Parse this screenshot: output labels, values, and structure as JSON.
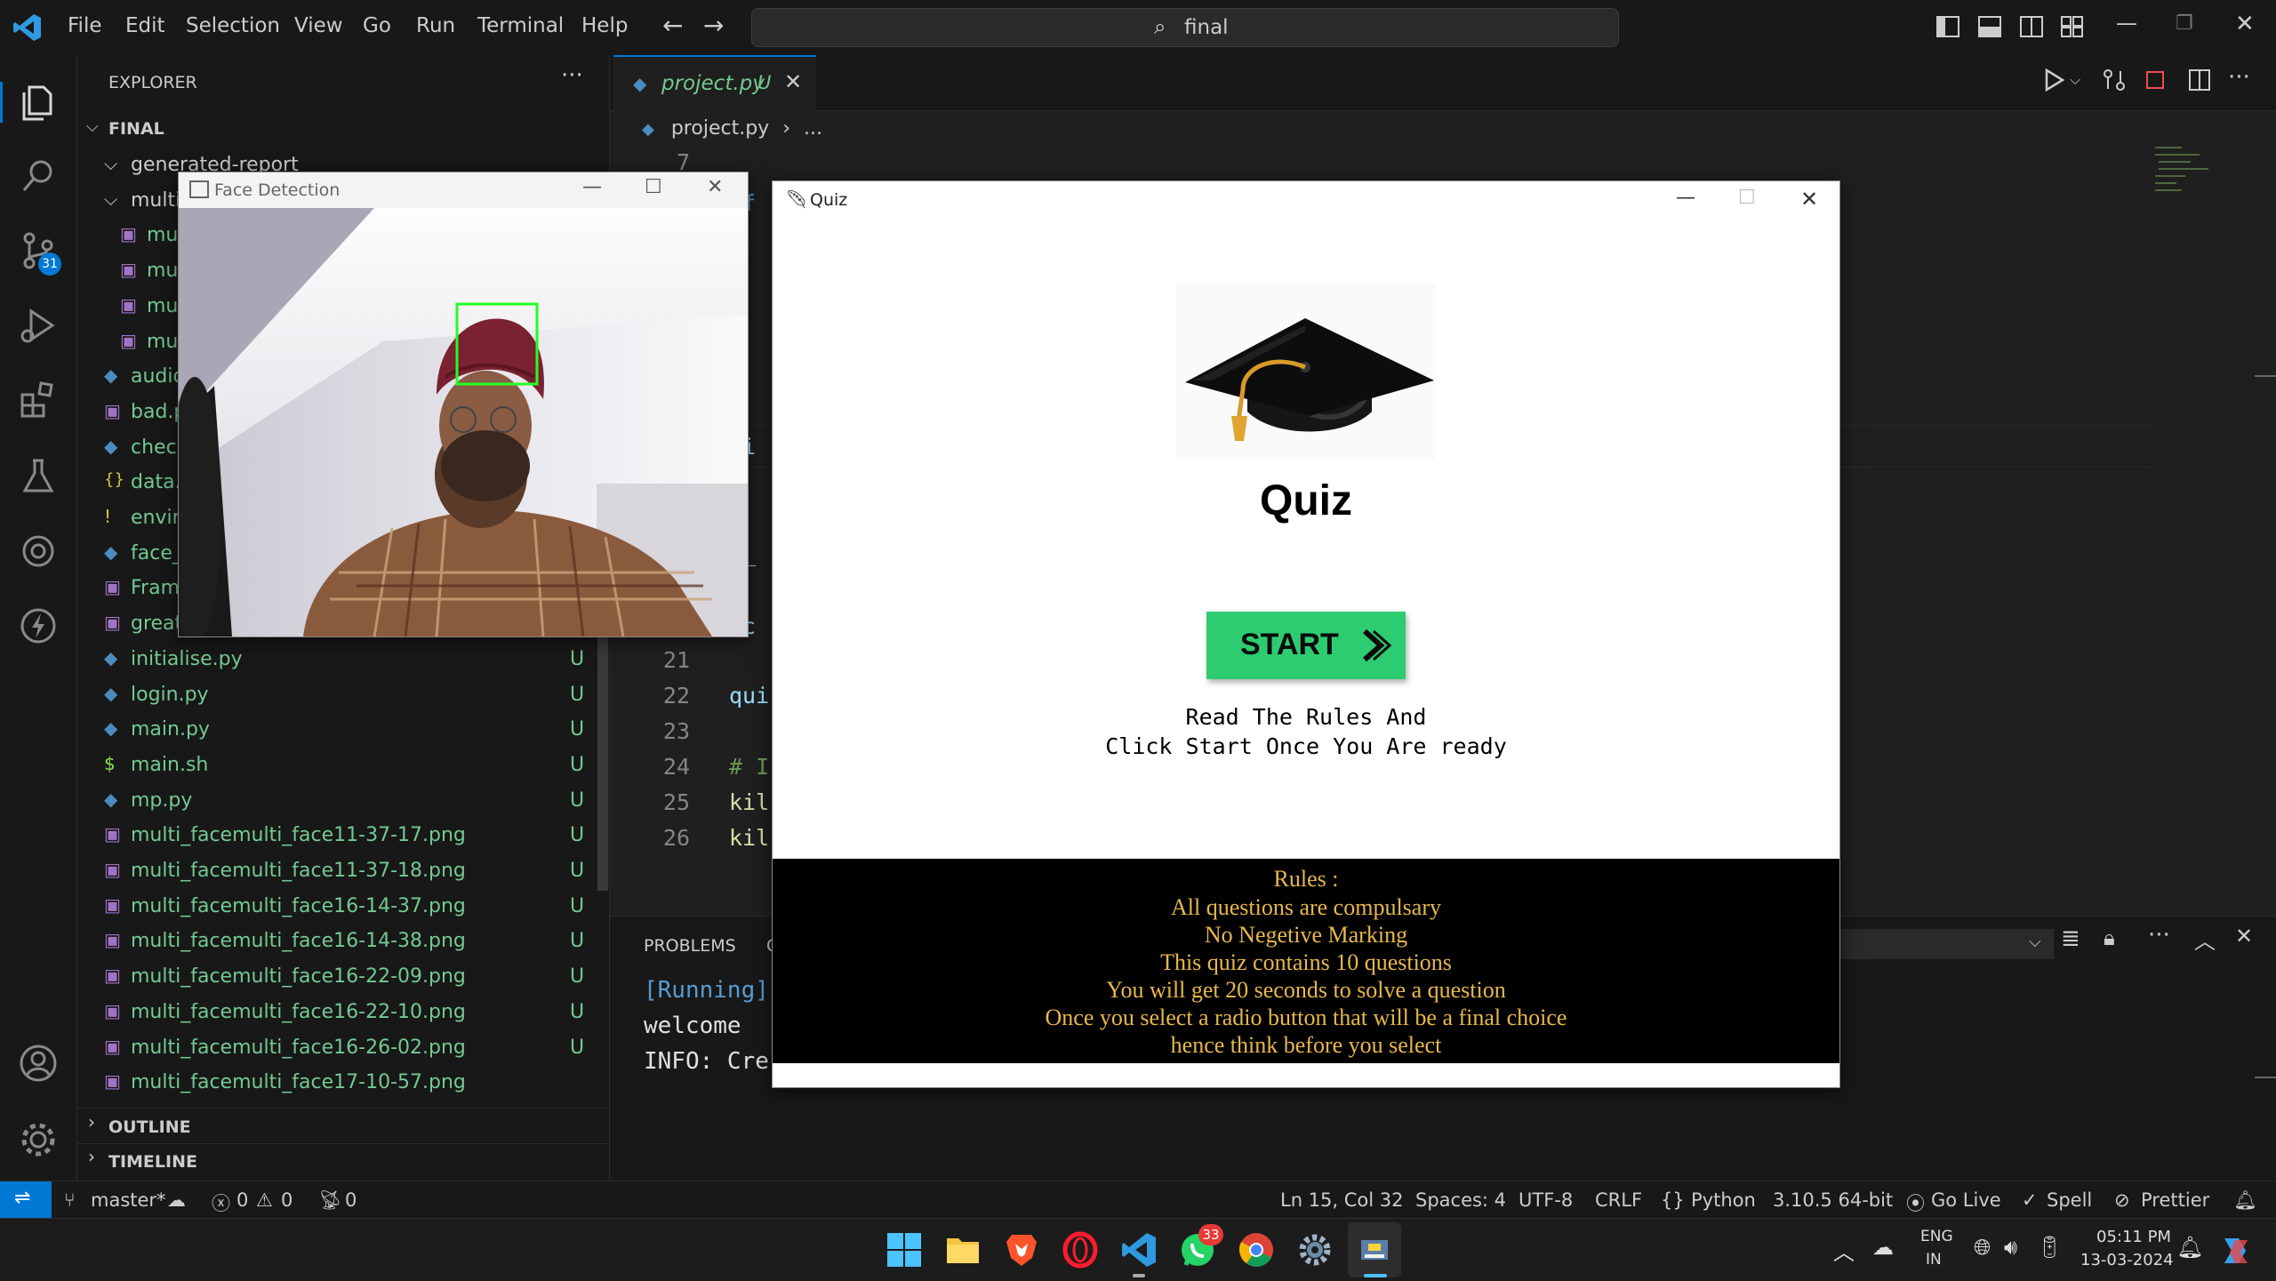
{
  "menu": [
    "File",
    "Edit",
    "Selection",
    "View",
    "Go",
    "Run",
    "Terminal",
    "Help"
  ],
  "command_center": "final",
  "activity": {
    "source_control_badge": "31"
  },
  "explorer": {
    "title": "EXPLORER",
    "root": "FINAL",
    "files": [
      {
        "name": "generated-report",
        "type": "folder",
        "status": ""
      },
      {
        "name": "multi",
        "type": "folder",
        "status": ""
      },
      {
        "name": "mul",
        "type": "image",
        "status": ""
      },
      {
        "name": "mul",
        "type": "image",
        "status": ""
      },
      {
        "name": "mul",
        "type": "image",
        "status": ""
      },
      {
        "name": "mul",
        "type": "image",
        "status": ""
      },
      {
        "name": "audio",
        "type": "python",
        "status": ""
      },
      {
        "name": "bad.p",
        "type": "image",
        "status": ""
      },
      {
        "name": "check",
        "type": "python",
        "status": ""
      },
      {
        "name": "data.j",
        "type": "json",
        "status": ""
      },
      {
        "name": "envir",
        "type": "env",
        "status": ""
      },
      {
        "name": "face_",
        "type": "python",
        "status": ""
      },
      {
        "name": "Fram",
        "type": "image",
        "status": ""
      },
      {
        "name": "great.png",
        "type": "image",
        "status": "U"
      },
      {
        "name": "initialise.py",
        "type": "python",
        "status": "U"
      },
      {
        "name": "login.py",
        "type": "python",
        "status": "U"
      },
      {
        "name": "main.py",
        "type": "python",
        "status": "U"
      },
      {
        "name": "main.sh",
        "type": "shell",
        "status": "U"
      },
      {
        "name": "mp.py",
        "type": "python",
        "status": "U"
      },
      {
        "name": "multi_facemulti_face11-37-17.png",
        "type": "image",
        "status": "U"
      },
      {
        "name": "multi_facemulti_face11-37-18.png",
        "type": "image",
        "status": "U"
      },
      {
        "name": "multi_facemulti_face16-14-37.png",
        "type": "image",
        "status": "U"
      },
      {
        "name": "multi_facemulti_face16-14-38.png",
        "type": "image",
        "status": "U"
      },
      {
        "name": "multi_facemulti_face16-22-09.png",
        "type": "image",
        "status": "U"
      },
      {
        "name": "multi_facemulti_face16-22-10.png",
        "type": "image",
        "status": "U"
      },
      {
        "name": "multi_facemulti_face16-26-02.png",
        "type": "image",
        "status": "U"
      },
      {
        "name": "multi_facemulti_face17-10-57.png",
        "type": "image",
        "status": ""
      }
    ],
    "outline": "OUTLINE",
    "timeline": "TIMELINE"
  },
  "editor": {
    "tab_label": "project.py",
    "tab_status": "U",
    "breadcrumb_file": "project.py",
    "breadcrumb_more": "...",
    "fragments": [
      {
        "ln": "7",
        "text": ""
      },
      {
        "ln": "",
        "text": "ef"
      },
      {
        "ln": "",
        "text": "L"
      },
      {
        "ln": "",
        "text": "ui"
      },
      {
        "ln": "",
        "text": "L"
      },
      {
        "ln": "",
        "text": "p_"
      },
      {
        "ln": "",
        "text": "ac"
      },
      {
        "ln": "21",
        "text": ""
      },
      {
        "ln": "22",
        "text": "qui"
      },
      {
        "ln": "23",
        "text": ""
      },
      {
        "ln": "24",
        "text": "# I"
      },
      {
        "ln": "25",
        "text": "kil"
      },
      {
        "ln": "26",
        "text": "kil"
      }
    ]
  },
  "panel": {
    "tab_problems": "PROBLEMS",
    "tab_output": "O",
    "lines": [
      "[Running]",
      "welcome",
      "INFO: Cre"
    ]
  },
  "status": {
    "branch": "master*",
    "errors": "0",
    "warnings": "0",
    "ports": "0",
    "position": "Ln 15, Col 32",
    "spaces": "Spaces: 4",
    "encoding": "UTF-8",
    "eol": "CRLF",
    "language": "Python",
    "interpreter": "3.10.5 64-bit",
    "golive": "Go Live",
    "spell": "Spell",
    "prettier": "Prettier"
  },
  "taskbar": {
    "whatsapp_badge": "33",
    "lang_top": "ENG",
    "lang_bottom": "IN",
    "time": "05:11 PM",
    "date": "13-03-2024"
  },
  "face_window": {
    "title": "Face Detection"
  },
  "quiz_window": {
    "title": "Quiz",
    "heading": "Quiz",
    "start_label": "START",
    "instructions_1": "Read The Rules And",
    "instructions_2": "Click Start Once You Are ready",
    "rules": [
      "Rules :",
      "All questions are compulsary",
      "No Negetive Marking",
      "This quiz contains 10 questions",
      "You will get 20 seconds to solve a question",
      "Once you select a radio button that will be a final choice",
      "hence think before you select"
    ],
    "colors": {
      "start_bg": "#2ecc71",
      "rules_bg": "#000000",
      "rules_fg": "#e8b84a"
    }
  }
}
